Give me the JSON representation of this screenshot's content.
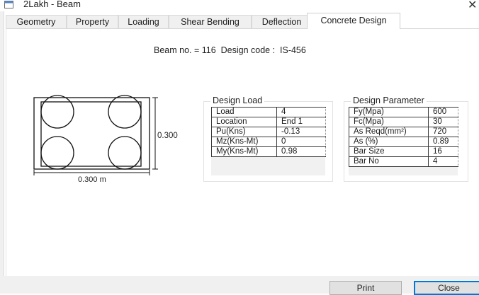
{
  "window": {
    "title": "2Lakh - Beam",
    "close_glyph": "✕"
  },
  "tabs": [
    {
      "label": "Geometry",
      "active": false
    },
    {
      "label": "Property",
      "active": false
    },
    {
      "label": "Loading",
      "active": false
    },
    {
      "label": "Shear Bending",
      "active": false
    },
    {
      "label": "Deflection",
      "active": false
    },
    {
      "label": "Concrete Design",
      "active": true
    }
  ],
  "beam_info": "Beam no. = 116  Design code :  IS-456",
  "section": {
    "height_label": "0.300",
    "width_label": "0.300 m",
    "bar_count": 4
  },
  "design_load": {
    "title": "Design Load",
    "rows": [
      {
        "label": "Load",
        "value": "4"
      },
      {
        "label": "Location",
        "value": "End 1"
      },
      {
        "label": "Pu(Kns)",
        "value": "-0.13"
      },
      {
        "label": "Mz(Kns-Mt)",
        "value": "0"
      },
      {
        "label": "My(Kns-Mt)",
        "value": "0.98"
      }
    ]
  },
  "design_parameter": {
    "title": "Design Parameter",
    "rows": [
      {
        "label": "Fy(Mpa)",
        "value": "600"
      },
      {
        "label": "Fc(Mpa)",
        "value": "30"
      },
      {
        "label": "As Reqd(mm²)",
        "value": "720"
      },
      {
        "label": "As (%)",
        "value": "0.89"
      },
      {
        "label": "Bar Size",
        "value": "16"
      },
      {
        "label": "Bar No",
        "value": "4"
      }
    ]
  },
  "buttons": {
    "print": "Print",
    "close": "Close"
  },
  "colors": {
    "accent": "#0078d7",
    "tab_bg": "#f0f0f0",
    "section_stroke": "#111111"
  }
}
